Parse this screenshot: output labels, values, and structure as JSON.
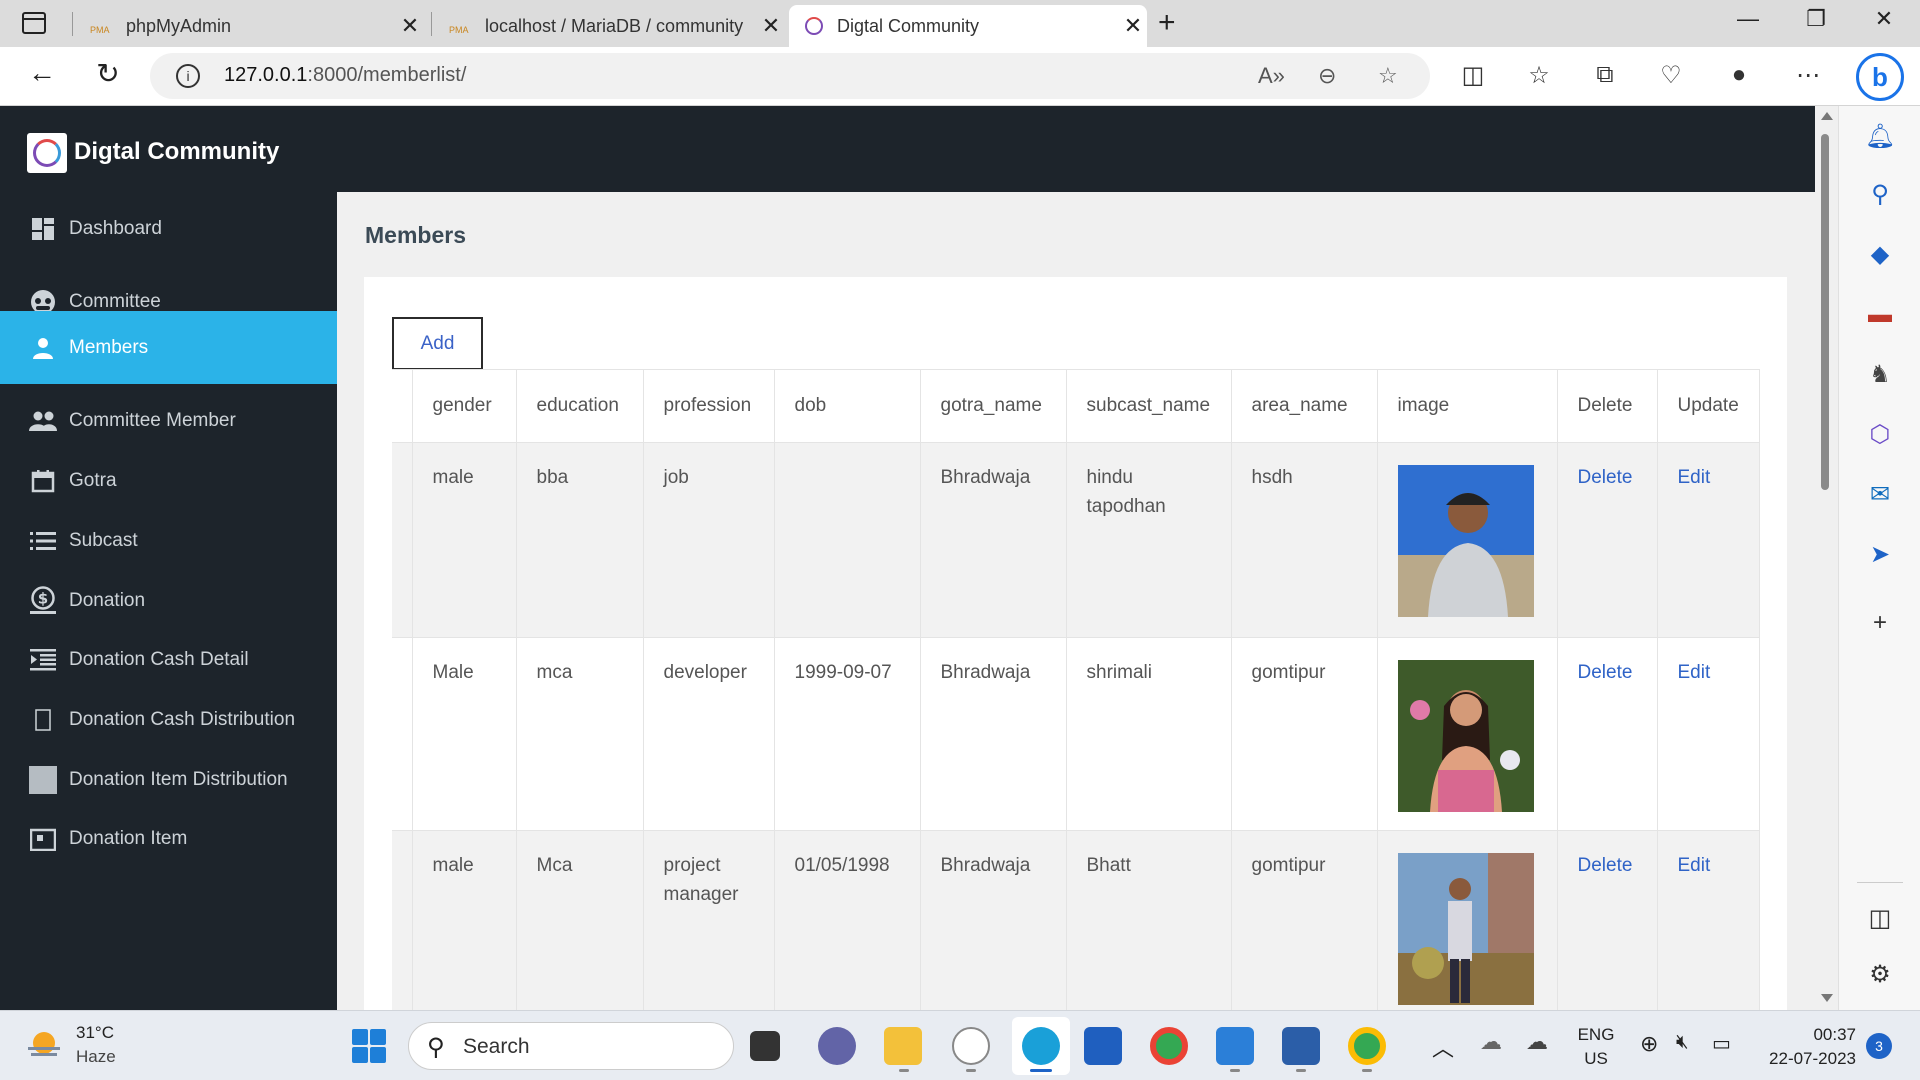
{
  "browser": {
    "tabs": [
      {
        "label": "phpMyAdmin",
        "favicon": "pma-icon"
      },
      {
        "label": "localhost / MariaDB / community",
        "favicon": "pma-icon"
      },
      {
        "label": "Digtal Community",
        "favicon": "community-logo-icon"
      }
    ],
    "favicon_text": "PMA",
    "url_host": "127.0.0.1",
    "url_path": ":8000/memberlist/"
  },
  "app": {
    "brand": "Digtal Community",
    "page_title": "Members",
    "add_label": "Add"
  },
  "sidebar": {
    "items": [
      {
        "label": "Dashboard",
        "icon": "dashboard-icon"
      },
      {
        "label": "Committee",
        "icon": "committee-icon"
      },
      {
        "label": "Members",
        "icon": "person-icon"
      },
      {
        "label": "Committee Member",
        "icon": "group-icon"
      },
      {
        "label": "Gotra",
        "icon": "calendar-icon"
      },
      {
        "label": "Subcast",
        "icon": "list-icon"
      },
      {
        "label": "Donation",
        "icon": "dollar-icon"
      },
      {
        "label": "Donation Cash Detail",
        "icon": "indent-list-icon"
      },
      {
        "label": "Donation Cash Distribution",
        "icon": "square-icon"
      },
      {
        "label": "Donation Item Distribution",
        "icon": "filled-square-icon"
      },
      {
        "label": "Donation Item",
        "icon": "box-icon"
      }
    ],
    "active_index": 2
  },
  "table": {
    "headers": [
      "gender",
      "education",
      "profession",
      "dob",
      "gotra_name",
      "subcast_name",
      "area_name",
      "image",
      "Delete",
      "Update"
    ],
    "rows": [
      {
        "gender": "male",
        "education": "bba",
        "profession": "job",
        "dob": "",
        "gotra_name": "Bhradwaja",
        "subcast_name": "hindu tapodhan",
        "area_name": "hsdh",
        "delete": "Delete",
        "update": "Edit"
      },
      {
        "gender": "Male",
        "education": "mca",
        "profession": "developer",
        "dob": "1999-09-07",
        "gotra_name": "Bhradwaja",
        "subcast_name": "shrimali",
        "area_name": "gomtipur",
        "delete": "Delete",
        "update": "Edit"
      },
      {
        "gender": "male",
        "education": "Mca",
        "profession": "project manager",
        "dob": "01/05/1998",
        "gotra_name": "Bhradwaja",
        "subcast_name": "Bhatt",
        "area_name": "gomtipur",
        "delete": "Delete",
        "update": "Edit"
      }
    ]
  },
  "taskbar": {
    "weather_temp": "31°C",
    "weather_desc": "Haze",
    "search_label": "Search",
    "lang_line1": "ENG",
    "lang_line2": "US",
    "time": "00:37",
    "date": "22-07-2023",
    "notification_count": "3"
  },
  "colors": {
    "header_bg": "#1d242b",
    "active_nav": "#2bb3e8",
    "link": "#2f63c7"
  }
}
